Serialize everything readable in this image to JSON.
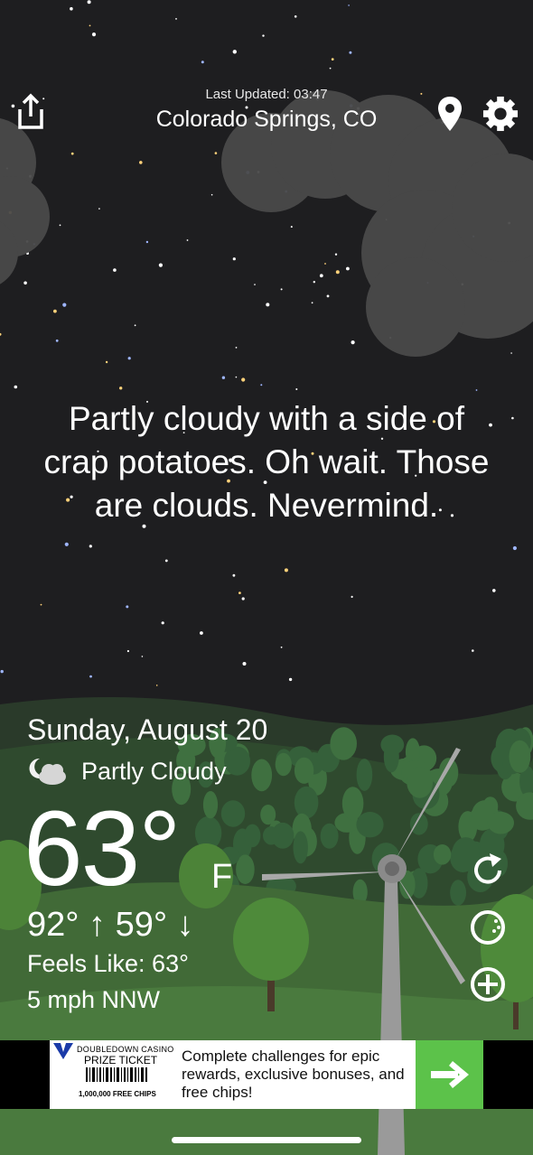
{
  "header": {
    "last_updated": "Last Updated: 03:47",
    "location": "Colorado Springs, CO",
    "share_icon": "share-icon",
    "location_icon": "location-pin-icon",
    "settings_icon": "gear-icon"
  },
  "forecast": {
    "quip": "Partly cloudy with a side of crap potatoes. Oh wait. Those are clouds. Nevermind."
  },
  "current": {
    "date": "Sunday, August 20",
    "condition_icon": "moon-cloud-icon",
    "condition": "Partly Cloudy",
    "temperature": "63°",
    "unit": "F",
    "high_low": "92° ↑  59° ↓",
    "feels_like": "Feels Like: 63°",
    "wind": "5 mph NNW"
  },
  "side_actions": {
    "refresh_icon": "refresh-icon",
    "theme_icon": "theme-toggle-icon",
    "add_icon": "add-icon"
  },
  "ad": {
    "brand_line": "DOUBLEDOWN CASINO",
    "ticket_title": "PRIZE TICKET",
    "ticket_amount": "1,000,000 FREE CHIPS",
    "body": "Complete challenges for epic rewards, exclusive bonuses, and free chips!",
    "arrow_icon": "arrow-right-icon"
  },
  "colors": {
    "sky": "#1e1e20",
    "hills": "#2d4a2c",
    "ad_accent": "#5cc24a"
  }
}
